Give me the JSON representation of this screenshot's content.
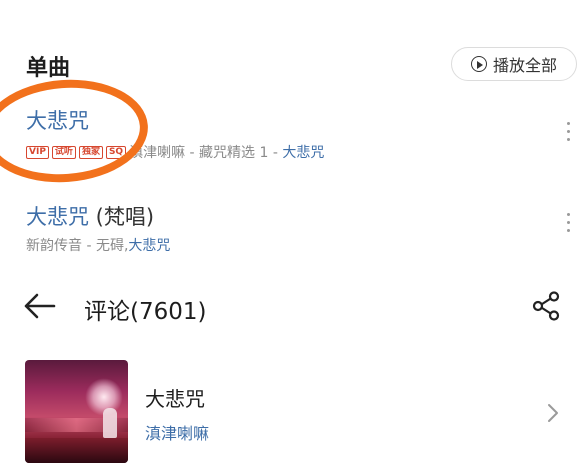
{
  "section": {
    "title": "单曲",
    "play_all_label": "播放全部",
    "play_icon": "play-circle-icon"
  },
  "songs": [
    {
      "title": "大悲咒",
      "title_suffix": "",
      "badges": [
        "VIP",
        "试听",
        "独家",
        "SQ"
      ],
      "artist": "滇津喇嘛",
      "album_prefix": " - 藏咒精选 1 - ",
      "album_link": "大悲咒"
    },
    {
      "title": "大悲咒",
      "title_suffix": " (梵唱)",
      "badges": [],
      "artist": "新韵传音",
      "album_prefix": " - 无碍,",
      "album_link": "大悲咒"
    }
  ],
  "comments": {
    "title": "评论(7601)",
    "back_icon": "back-arrow-icon",
    "share_icon": "share-icon"
  },
  "album": {
    "title": "大悲咒",
    "artist": "滇津喇嘛"
  },
  "colors": {
    "link_blue": "#3e6ea8",
    "badge_red": "#d7472f",
    "annotation_orange": "#f2711c"
  }
}
